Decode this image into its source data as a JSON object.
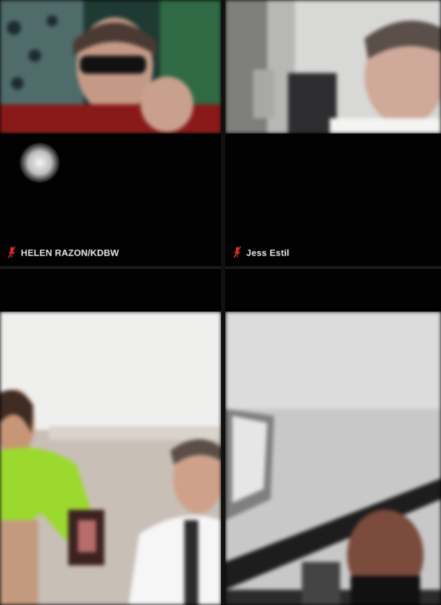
{
  "participants": [
    {
      "name": "HELEN RAZON/KDBW",
      "mic_muted": true,
      "mic_color": "#e0312a"
    },
    {
      "name": "Jess Estil",
      "mic_muted": true,
      "mic_color": "#e0312a"
    },
    {
      "name": "",
      "mic_muted": false
    },
    {
      "name": "",
      "mic_muted": false
    }
  ]
}
